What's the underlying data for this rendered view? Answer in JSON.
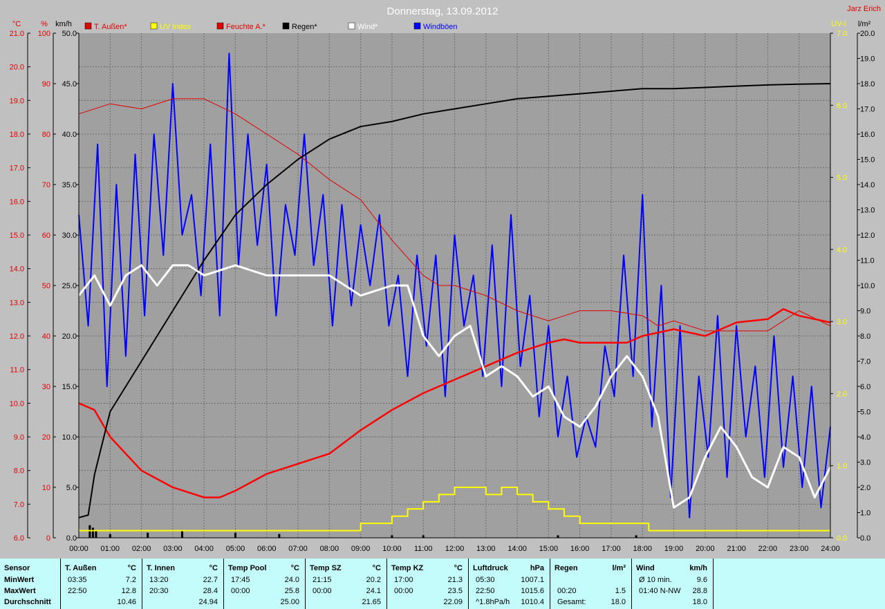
{
  "header": {
    "date": "Donnerstag, 13.09.2012",
    "owner": "Jarz Erich"
  },
  "axis_units": {
    "temp": "°C",
    "humidity": "%",
    "wind": "km/h",
    "uv": "UV-I",
    "rain": "l/m²"
  },
  "colors": {
    "temp": "#ff0000",
    "uv": "#ffff00",
    "humidity": "#ff0000",
    "rain": "#000000",
    "wind": "#ffffff",
    "gust": "#0000ff",
    "plot_bg": "#a0a0a0",
    "stats_bg": "#c4fcfc"
  },
  "chart_data": {
    "type": "line",
    "legend": [
      "T. Außen*",
      "UV Index",
      "Feuchte A.*",
      "Regen*",
      "Wind*",
      "Windböen"
    ],
    "legend_colors": [
      "#e00000",
      "#ffff00",
      "#e00000",
      "#000000",
      "#ffffff",
      "#0000ff"
    ],
    "x_ticks": [
      "00:00",
      "01:00",
      "02:00",
      "03:00",
      "04:00",
      "05:00",
      "06:00",
      "07:00",
      "08:00",
      "09:00",
      "10:00",
      "11:00",
      "12:00",
      "13:00",
      "14:00",
      "15:00",
      "16:00",
      "17:00",
      "18:00",
      "19:00",
      "20:00",
      "21:00",
      "22:00",
      "23:00",
      "24:00"
    ],
    "axes": {
      "temp_ticks": [
        "21.0",
        "20.0",
        "19.0",
        "18.0",
        "17.0",
        "16.0",
        "15.0",
        "14.0",
        "13.0",
        "12.0",
        "11.0",
        "10.0",
        "9.0",
        "8.0",
        "7.0",
        "6.0"
      ],
      "humidity_ticks": [
        "100",
        "90",
        "80",
        "70",
        "60",
        "50",
        "40",
        "30",
        "20",
        "10",
        "0"
      ],
      "wind_ticks": [
        "50.0",
        "45.0",
        "40.0",
        "35.0",
        "30.0",
        "25.0",
        "20.0",
        "15.0",
        "10.0",
        "5.0",
        "0.0"
      ],
      "uv_ticks": [
        "7.0",
        "6.0",
        "5.0",
        "4.0",
        "3.0",
        "2.0",
        "1.0",
        "0.0"
      ],
      "rain_ticks": [
        "20.0",
        "19.0",
        "18.0",
        "17.0",
        "16.0",
        "15.0",
        "14.0",
        "13.0",
        "12.0",
        "11.0",
        "10.0",
        "9.0",
        "8.0",
        "7.0",
        "6.0",
        "5.0",
        "4.0",
        "3.0",
        "2.0",
        "1.0",
        "0.0"
      ],
      "temp_range": [
        6,
        21
      ],
      "humidity_range": [
        0,
        100
      ],
      "wind_range": [
        0,
        50
      ],
      "uv_range": [
        0,
        7
      ],
      "rain_range": [
        0,
        20
      ]
    },
    "series": [
      {
        "name": "T. Außen*",
        "axis": "temp",
        "x": [
          0,
          0.5,
          1,
          2,
          3,
          4,
          4.5,
          5,
          6,
          7,
          8,
          9,
          10,
          11,
          12,
          13,
          14,
          15,
          15.5,
          16,
          17,
          17.5,
          18,
          19,
          20,
          21,
          22,
          22.5,
          23,
          23.5,
          24
        ],
        "y": [
          10.0,
          9.8,
          9.0,
          8.0,
          7.5,
          7.2,
          7.2,
          7.4,
          7.9,
          8.2,
          8.5,
          9.2,
          9.8,
          10.3,
          10.7,
          11.1,
          11.5,
          11.8,
          11.9,
          11.8,
          11.8,
          11.8,
          12.0,
          12.2,
          12.0,
          12.4,
          12.5,
          12.8,
          12.6,
          12.5,
          12.4
        ]
      },
      {
        "name": "Feuchte A.*",
        "axis": "humidity",
        "x": [
          0,
          1,
          2,
          3,
          4,
          5,
          6,
          7,
          8,
          9,
          10,
          11,
          11.5,
          12,
          13,
          14,
          15,
          15.5,
          16,
          17,
          18,
          18.5,
          19,
          20,
          21,
          22,
          23,
          24
        ],
        "y": [
          84,
          86,
          85,
          87,
          87,
          84,
          80,
          76,
          71,
          67,
          59,
          52,
          50,
          50,
          48,
          45,
          43,
          44,
          45,
          45,
          44,
          42,
          43,
          41,
          41,
          41,
          45,
          42
        ]
      },
      {
        "name": "Regen*",
        "axis": "rain",
        "x": [
          0,
          0.3,
          0.5,
          1,
          2,
          3,
          4,
          5,
          6,
          7,
          8,
          9,
          10,
          11,
          12,
          13,
          14,
          15,
          16,
          17,
          18,
          19,
          20,
          21,
          22,
          23,
          24
        ],
        "y": [
          0.8,
          0.9,
          2.5,
          5.0,
          7.0,
          9.0,
          11.0,
          12.8,
          14.0,
          15.0,
          15.8,
          16.3,
          16.5,
          16.8,
          17.0,
          17.2,
          17.4,
          17.5,
          17.6,
          17.7,
          17.8,
          17.8,
          17.85,
          17.9,
          17.95,
          17.98,
          18.0
        ]
      },
      {
        "name": "Wind*",
        "axis": "wind",
        "x": [
          0,
          0.5,
          1,
          1.5,
          2,
          2.5,
          3,
          3.5,
          4,
          5,
          6,
          7,
          8,
          9,
          10,
          10.5,
          11,
          11.5,
          12,
          12.5,
          13,
          13.5,
          14,
          14.5,
          15,
          15.5,
          16,
          16.5,
          17,
          17.5,
          18,
          18.5,
          19,
          19.5,
          20,
          20.5,
          21,
          21.5,
          22,
          22.5,
          23,
          23.5,
          24
        ],
        "y": [
          24,
          26,
          23,
          26,
          27,
          25,
          27,
          27,
          26,
          27,
          26,
          26,
          26,
          24,
          25,
          25,
          20,
          18,
          20,
          21,
          16,
          17,
          16,
          14,
          15,
          12,
          11,
          13,
          16,
          18,
          16,
          12,
          3,
          4,
          8,
          11,
          9,
          6,
          5,
          9,
          8,
          4,
          7
        ]
      },
      {
        "name": "Windböen",
        "axis": "wind",
        "x": [
          0,
          0.3,
          0.6,
          0.9,
          1.2,
          1.5,
          1.8,
          2.1,
          2.4,
          2.7,
          3.0,
          3.3,
          3.6,
          3.9,
          4.2,
          4.5,
          4.8,
          5.1,
          5.4,
          5.7,
          6.0,
          6.3,
          6.6,
          6.9,
          7.2,
          7.5,
          7.8,
          8.1,
          8.4,
          8.7,
          9.0,
          9.3,
          9.6,
          9.9,
          10.2,
          10.5,
          10.8,
          11.1,
          11.4,
          11.7,
          12.0,
          12.3,
          12.6,
          12.9,
          13.2,
          13.5,
          13.8,
          14.1,
          14.4,
          14.7,
          15.0,
          15.3,
          15.6,
          15.9,
          16.2,
          16.5,
          16.8,
          17.1,
          17.4,
          17.7,
          18.0,
          18.3,
          18.6,
          18.9,
          19.2,
          19.5,
          19.8,
          20.1,
          20.4,
          20.7,
          21.0,
          21.3,
          21.6,
          21.9,
          22.2,
          22.5,
          22.8,
          23.1,
          23.4,
          23.7,
          24.0
        ],
        "y": [
          32,
          21,
          39,
          15,
          35,
          18,
          38,
          22,
          40,
          28,
          45,
          30,
          34,
          24,
          39,
          22,
          48,
          27,
          40,
          29,
          37,
          22,
          33,
          28,
          40,
          27,
          34,
          21,
          33,
          23,
          31,
          25,
          32,
          21,
          26,
          16,
          28,
          19,
          28,
          14,
          30,
          21,
          26,
          16,
          29,
          15,
          32,
          17,
          24,
          12,
          21,
          10,
          16,
          8,
          12,
          9,
          19,
          14,
          28,
          16,
          34,
          11,
          25,
          4,
          21,
          2,
          16,
          8,
          22,
          6,
          21,
          10,
          17,
          6,
          20,
          7,
          16,
          5,
          15,
          3,
          11
        ]
      }
    ],
    "rain_bars": {
      "x": [
        0.35,
        0.45,
        0.55,
        1.0,
        2.2,
        3.3,
        5.0,
        6.4,
        10.0,
        11.0,
        15.3,
        17.8
      ],
      "y": [
        0.5,
        0.4,
        0.3,
        0.15,
        0.2,
        0.3,
        0.2,
        0.15,
        0.1,
        0.1,
        0.1,
        0.1
      ]
    },
    "uv_steps": {
      "x": [
        0,
        8.5,
        9,
        10,
        10.5,
        11,
        11.5,
        12,
        12.5,
        13,
        13.5,
        14,
        14.5,
        15,
        15.5,
        16,
        17,
        18,
        18.2,
        24
      ],
      "y": [
        0.1,
        0.1,
        0.2,
        0.3,
        0.4,
        0.5,
        0.6,
        0.7,
        0.7,
        0.6,
        0.7,
        0.6,
        0.5,
        0.4,
        0.3,
        0.2,
        0.2,
        0.2,
        0.1,
        0.1
      ]
    }
  },
  "stats": {
    "label_col": {
      "title": "Sensor",
      "rows": [
        "MinWert",
        "MaxWert",
        "Durchschnitt"
      ]
    },
    "groups": [
      {
        "title": "T. Außen",
        "unit": "°C",
        "rows": [
          [
            "03:35",
            "7.2"
          ],
          [
            "22:50",
            "12.8"
          ],
          [
            "",
            "10.46"
          ]
        ]
      },
      {
        "title": "T. Innen",
        "unit": "°C",
        "rows": [
          [
            "13:20",
            "22.7"
          ],
          [
            "20:30",
            "28.4"
          ],
          [
            "",
            "24.94"
          ]
        ]
      },
      {
        "title": "Temp Pool",
        "unit": "°C",
        "rows": [
          [
            "17:45",
            "24.0"
          ],
          [
            "00:00",
            "25.8"
          ],
          [
            "",
            "25.00"
          ]
        ]
      },
      {
        "title": "Temp SZ",
        "unit": "°C",
        "rows": [
          [
            "21:15",
            "20.2"
          ],
          [
            "00:00",
            "24.1"
          ],
          [
            "",
            "21.65"
          ]
        ]
      },
      {
        "title": "Temp KZ",
        "unit": "°C",
        "rows": [
          [
            "17:00",
            "21.3"
          ],
          [
            "00:00",
            "23.5"
          ],
          [
            "",
            "22.09"
          ]
        ]
      },
      {
        "title": "Luftdruck",
        "unit": "hPa",
        "rows": [
          [
            "05:30",
            "1007.1"
          ],
          [
            "22:50",
            "1015.6"
          ],
          [
            "^1.8hPa/h",
            "1010.4"
          ]
        ]
      },
      {
        "title": "Regen",
        "unit": "l/m²",
        "rows": [
          [
            "",
            ""
          ],
          [
            "00:20",
            "1.5"
          ],
          [
            "Gesamt:",
            "18.0"
          ]
        ]
      },
      {
        "title": "Wind",
        "unit": "km/h",
        "rows": [
          [
            "Ø 10 min.",
            "9.6"
          ],
          [
            "01:40   N-NW",
            "28.8"
          ],
          [
            "",
            "18.0"
          ]
        ]
      }
    ]
  }
}
